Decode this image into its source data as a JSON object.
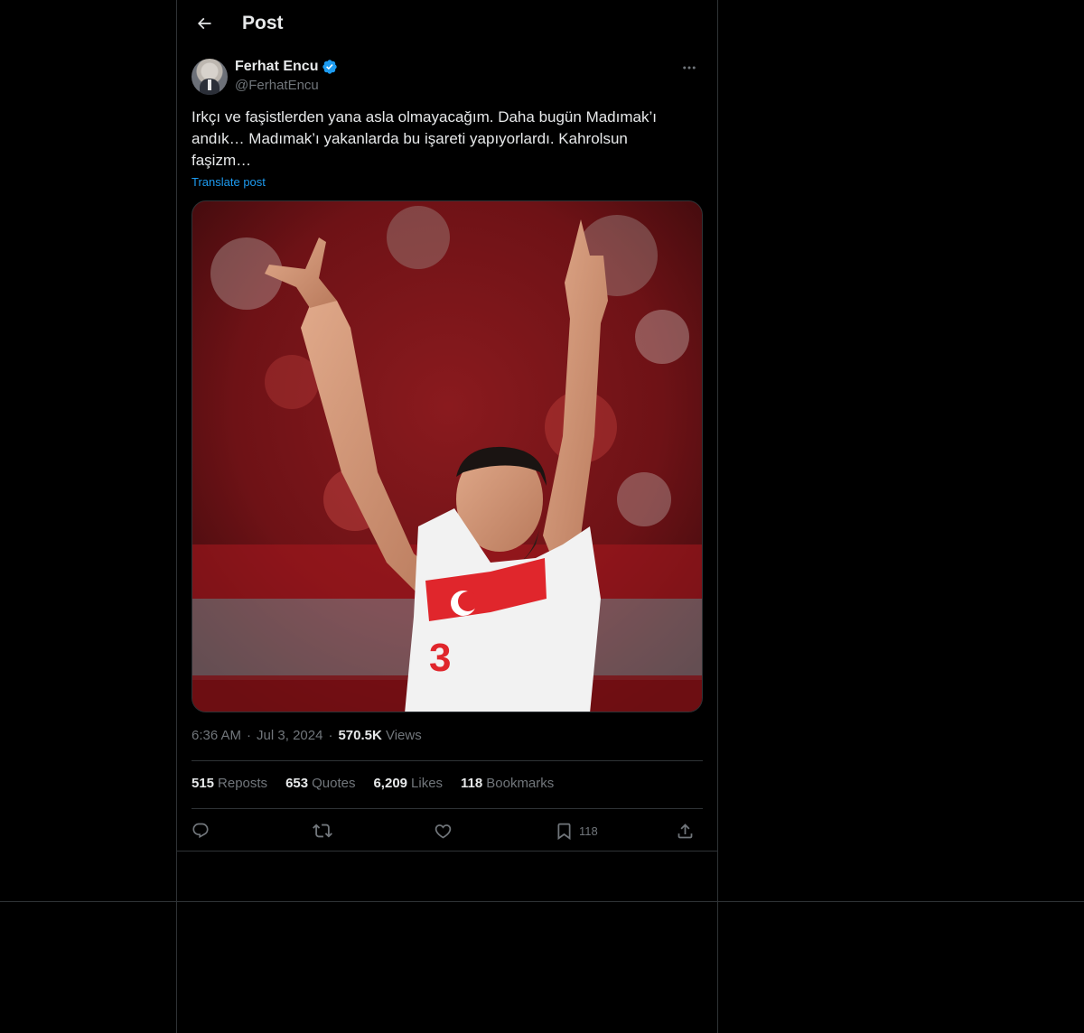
{
  "header": {
    "title": "Post",
    "back_icon": "arrow-left-icon"
  },
  "author": {
    "display_name": "Ferhat Encu",
    "handle": "@FerhatEncu",
    "verified": true,
    "verified_color": "#1d9bf0"
  },
  "tweet": {
    "text": "Irkçı ve faşistlerden yana asla olmayacağım. Daha bugün Madımak’ı\nandık… Madımak’ı yakanlarda bu işareti yapıyorlardı. Kahrolsun\nfaşizm…",
    "translate_label": "Translate post"
  },
  "meta": {
    "time": "6:36 AM",
    "separator": "·",
    "date": "Jul 3, 2024",
    "views_count": "570.5K",
    "views_label": "Views"
  },
  "stats": {
    "reposts_count": "515",
    "reposts_label": "Reposts",
    "quotes_count": "653",
    "quotes_label": "Quotes",
    "likes_count": "6,209",
    "likes_label": "Likes",
    "bookmarks_count": "118",
    "bookmarks_label": "Bookmarks"
  },
  "actions": {
    "reply_icon": "reply-icon",
    "repost_icon": "repost-icon",
    "like_icon": "heart-icon",
    "bookmark_icon": "bookmark-icon",
    "bookmark_count": "118",
    "share_icon": "share-icon"
  },
  "colors": {
    "background": "#000000",
    "text": "#e7e9ea",
    "muted": "#71767b",
    "border": "#2f3336",
    "link": "#1d9bf0"
  }
}
